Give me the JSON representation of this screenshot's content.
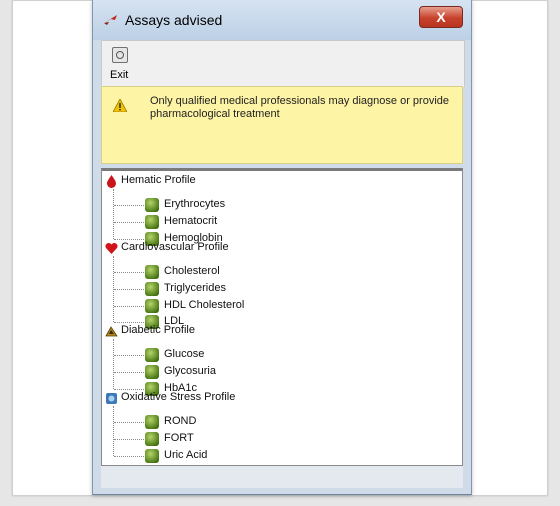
{
  "window": {
    "title": "Assays advised",
    "close_label": "X"
  },
  "toolbar": {
    "exit_label": "Exit"
  },
  "warning": {
    "text": "Only qualified medical professionals may diagnose or provide pharmacological treatment"
  },
  "tree": {
    "groups": [
      {
        "label": "Hematic Profile",
        "icon": "blood-drop-icon",
        "items": [
          "Erythrocytes",
          "Hematocrit",
          "Hemoglobin"
        ]
      },
      {
        "label": "Cardiovascular Profile",
        "icon": "heart-icon",
        "items": [
          "Cholesterol",
          "Triglycerides",
          "HDL Cholesterol",
          "LDL"
        ]
      },
      {
        "label": "Diabetic Profile",
        "icon": "diabetes-icon",
        "items": [
          "Glucose",
          "Glycosuria",
          "HbA1c"
        ]
      },
      {
        "label": "Oxidative Stress Profile",
        "icon": "oxidative-icon",
        "items": [
          "ROND",
          "FORT",
          "Uric Acid"
        ]
      }
    ]
  },
  "colors": {
    "accent": "#cfdbe8",
    "warning_bg": "#fef4a6",
    "close": "#c7422c",
    "leaf": "#4d7d18"
  }
}
